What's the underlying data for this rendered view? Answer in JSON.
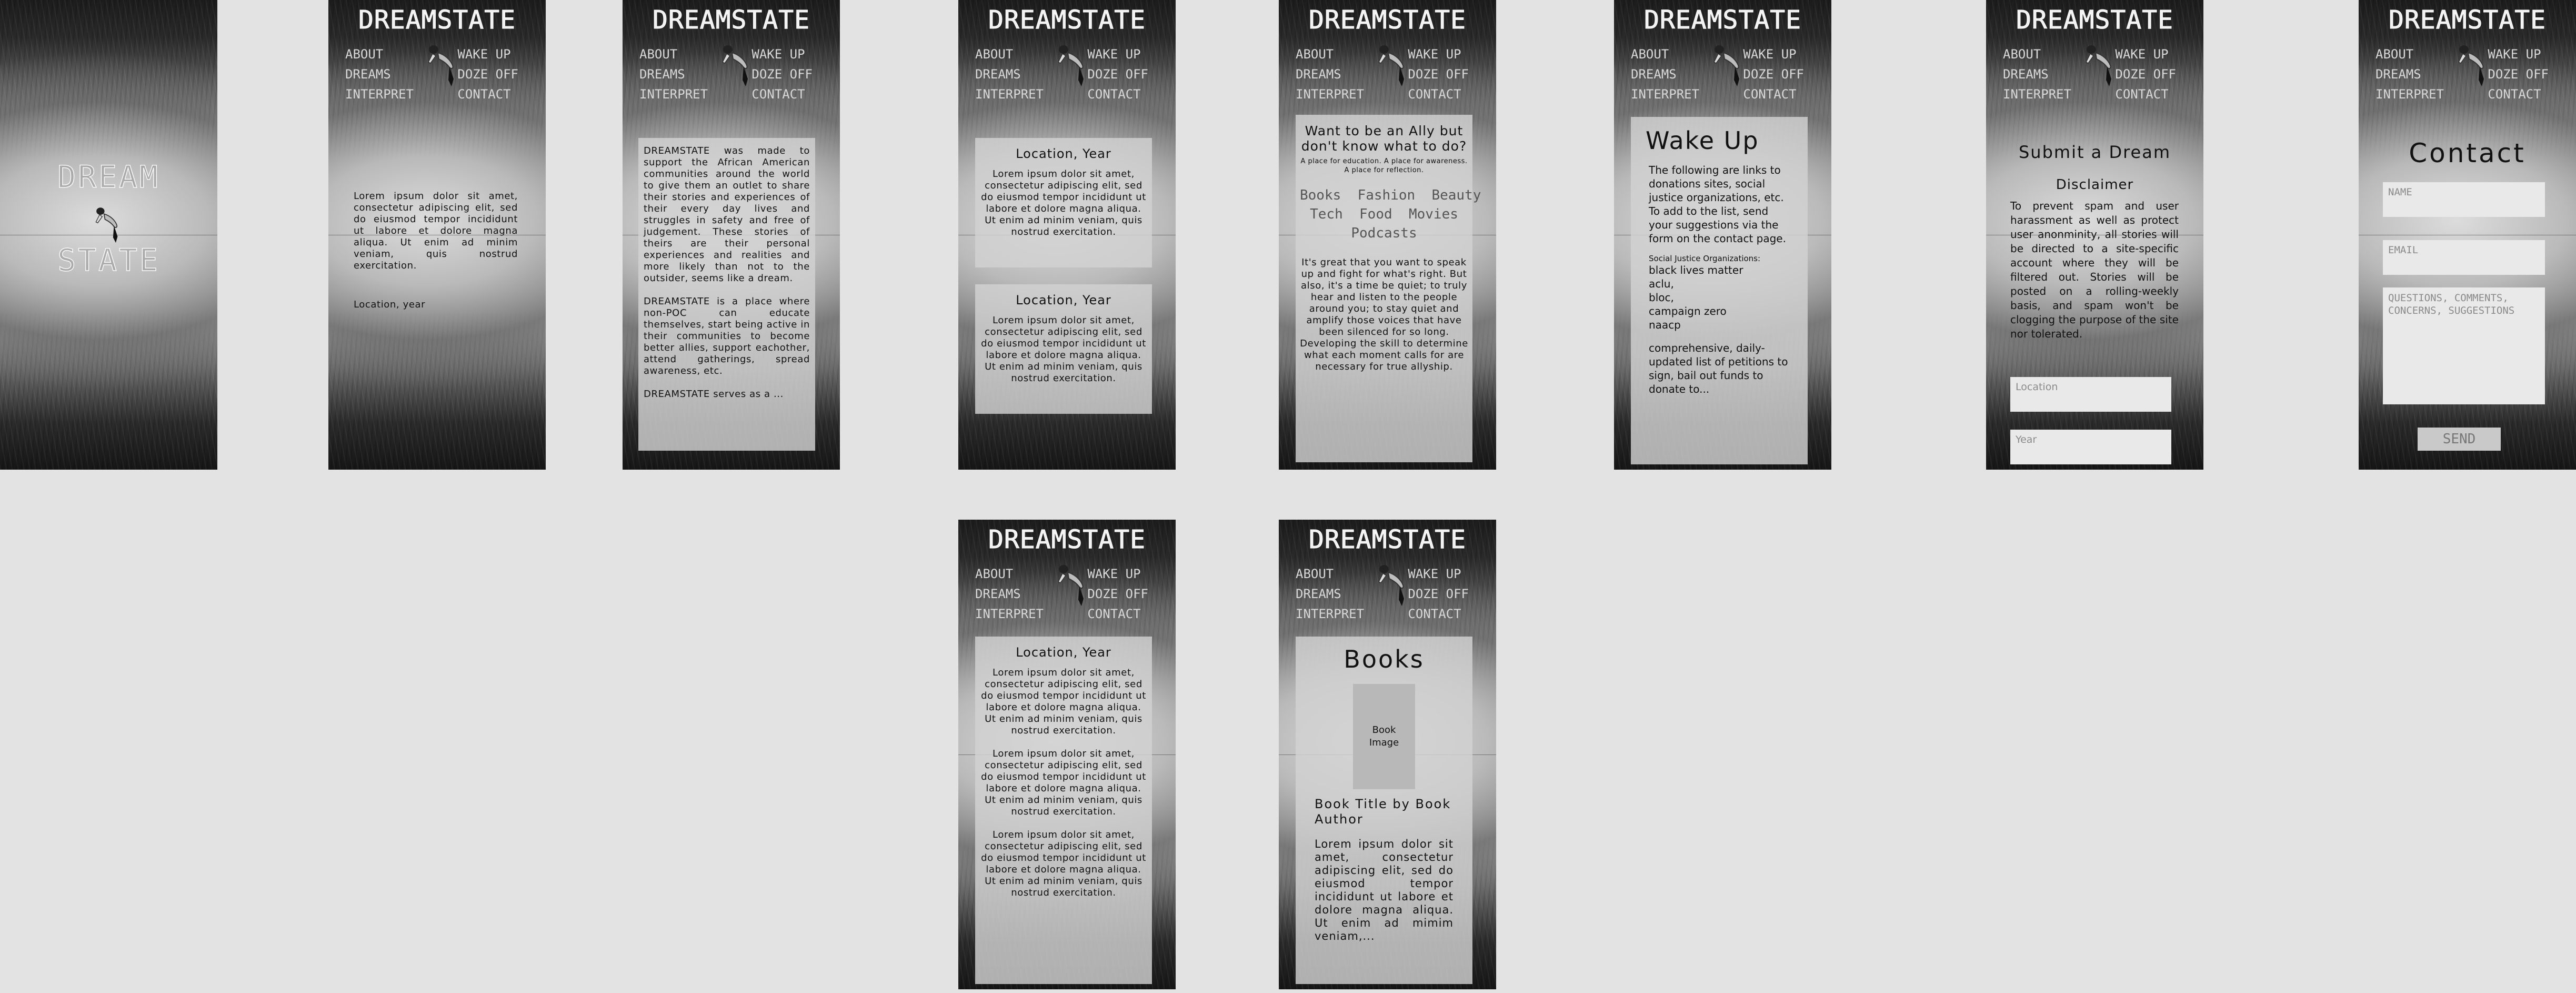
{
  "brand": "DREAMSTATE",
  "nav": {
    "about": "ABOUT",
    "dreams": "DREAMS",
    "interpret": "INTERPRET",
    "wake_up": "WAKE UP",
    "doze_off": "DOZE OFF",
    "contact": "CONTACT"
  },
  "splash": {
    "word1": "DREAM",
    "word2": "STATE"
  },
  "dreams_page": {
    "body": "Lorem ipsum dolor sit amet, consectetur adipiscing elit, sed do eiusmod tempor incididunt ut labore et dolore magna aliqua. Ut enim ad minim veniam, quis nostrud exercitation.",
    "meta": "Location, year"
  },
  "about_page": {
    "para1": "DREAMSTATE was made to support the African American communities around the world to give them an outlet to share their stories and experiences of their every day lives and struggles in safety and free of judgement. These stories of theirs are their personal experiences and realities and more likely than not to the outsider, seems like a dream.",
    "para2": "DREAMSTATE is a place where non-POC can educate themselves, start being active in their communities to become better allies, support eachother, attend gatherings, spread awareness, etc.",
    "para3": "DREAMSTATE serves as a ..."
  },
  "interpret_page": {
    "card1_title": "Location, Year",
    "card1_body": "Lorem ipsum dolor sit amet, consectetur adipiscing elit, sed do eiusmod tempor incididunt ut labore et dolore magna aliqua. Ut enim ad minim veniam, quis nostrud exercitation.",
    "card2_title": "Location, Year",
    "card2_body": "Lorem ipsum dolor sit amet, consectetur adipiscing elit, sed do eiusmod tempor incididunt ut labore et dolore magna aliqua. Ut enim ad minim veniam, quis nostrud exercitation."
  },
  "ally_page": {
    "title": "Want to be an Ally but don't know what to do?",
    "subtitle": "A place for education. A place for awareness. A place for reflection.",
    "cat_row1": "Books  Fashion  Beauty",
    "cat_row2": "Tech  Food  Movies",
    "cat_row3": "Podcasts",
    "body": "It's great that you want to speak up and fight for what's right. But also, it's a time be quiet; to truly hear and listen to the people around you; to stay quiet and amplify those voices that have been silenced for so long. Developing the skill to determine what each moment calls for are necessary for true allyship."
  },
  "wakeup_page": {
    "title": "Wake Up",
    "intro": "The following are links to donations sites, social justice organizations, etc. To add to the list, send your suggestions via the form on the contact page.",
    "orgs_heading": "Social Justice Organizations:",
    "orgs": "black lives matter\naclu,\nbloc,\ncampaign zero\nnaacp",
    "tail": "comprehensive, daily-updated list of petitions to sign, bail out funds to donate to..."
  },
  "submit_page": {
    "title": "Submit a Dream",
    "disclaimer_title": "Disclaimer",
    "disclaimer": "To prevent spam and user harassment as well as protect user anonminity, all stories will be directed to a site-specific account where they will be filtered out. Stories will be posted on a rolling-weekly basis, and spam won't be clogging the purpose of the site nor tolerated.",
    "location_placeholder": "Location",
    "year_placeholder": "Year"
  },
  "contact_page": {
    "title": "Contact",
    "name_placeholder": "NAME",
    "email_placeholder": "EMAIL",
    "message_placeholder": "QUESTIONS, COMMENTS, CONCERNS, SUGGESTIONS",
    "send": "SEND"
  },
  "dreams_list_page": {
    "title": "Location, Year",
    "p1": "Lorem ipsum dolor sit amet, consectetur adipiscing elit, sed do eiusmod tempor incididunt ut labore et dolore magna aliqua. Ut enim ad minim veniam, quis nostrud exercitation.",
    "p2": "Lorem ipsum dolor sit amet, consectetur adipiscing elit, sed do eiusmod tempor incididunt ut labore et dolore magna aliqua. Ut enim ad minim veniam, quis nostrud exercitation.",
    "p3": "Lorem ipsum dolor sit amet, consectetur adipiscing elit, sed do eiusmod tempor incididunt ut labore et dolore magna aliqua. Ut enim ad minim veniam, quis nostrud exercitation."
  },
  "books_page": {
    "title": "Books",
    "image_label": "Book Image",
    "book_title": "Book Title by Book Author",
    "body": "Lorem ipsum dolor sit amet, consectetur adipiscing elit, sed do eiusmod tempor incididunt ut labore et dolore magna aliqua. Ut enim ad mimim veniam,..."
  }
}
